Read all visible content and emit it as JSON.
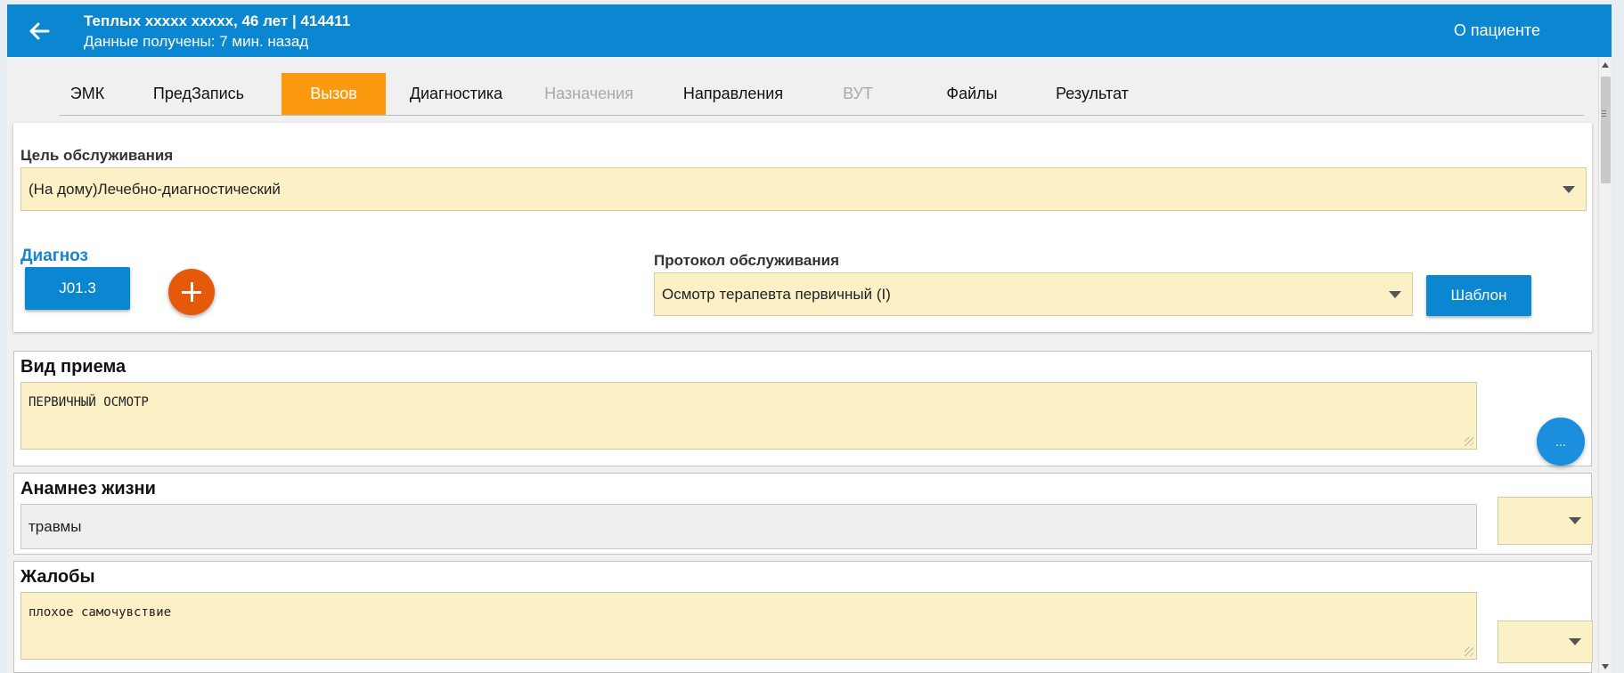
{
  "header": {
    "title": "Теплых xxxxx xxxxx, 46 лет | 414411",
    "subtitle": "Данные получены: 7 мин. назад",
    "about_patient": "О пациенте",
    "color": "#0a87d0"
  },
  "tabs": [
    {
      "label": "ЭМК",
      "state": "normal"
    },
    {
      "label": "ПредЗапись",
      "state": "normal"
    },
    {
      "label": "Вызов",
      "state": "active"
    },
    {
      "label": "Диагностика",
      "state": "normal"
    },
    {
      "label": "Назначения",
      "state": "disabled"
    },
    {
      "label": "Направления",
      "state": "normal"
    },
    {
      "label": "ВУТ",
      "state": "disabled"
    },
    {
      "label": "Файлы",
      "state": "normal"
    },
    {
      "label": "Результат",
      "state": "normal"
    }
  ],
  "service_goal": {
    "label": "Цель обслуживания",
    "value": "(На дому)Лечебно-диагностический"
  },
  "diagnosis": {
    "label": "Диагноз",
    "code": "J01.3"
  },
  "protocol": {
    "label": "Протокол обслуживания",
    "value": "Осмотр терапевта первичный (I)",
    "template_button": "Шаблон"
  },
  "sections": {
    "visit_type": {
      "title": "Вид приема",
      "value": "ПЕРВИЧНЫЙ ОСМОТР"
    },
    "life_anamnesis": {
      "title": "Анамнез жизни",
      "value": "травмы"
    },
    "complaints": {
      "title": "Жалобы",
      "value": "плохое самочувствие"
    }
  },
  "fab_more_label": "...",
  "colors": {
    "accent_orange": "#fb9a0e",
    "add_button": "#e45a0a",
    "field_bg": "#fbf0c6"
  }
}
